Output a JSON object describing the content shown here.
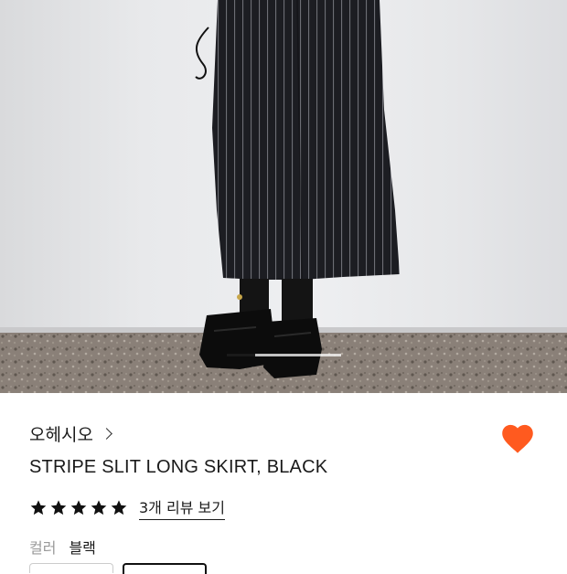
{
  "product": {
    "brand": "오헤시오",
    "title": "STRIPE SLIT LONG SKIRT, BLACK",
    "rating": 5,
    "review_link": "3개 리뷰 보기",
    "favorited": true
  },
  "options": {
    "label": "컬러",
    "value": "블랙"
  },
  "carousel": {
    "progress": 0.25
  },
  "colors": {
    "heart": "#ff5a1f",
    "star": "#111111",
    "text": "#1a1a1a",
    "muted": "#999999"
  },
  "icons": {
    "brand_chevron": "chevron-right-icon",
    "favorite": "heart-icon",
    "rating": "star-icon"
  }
}
